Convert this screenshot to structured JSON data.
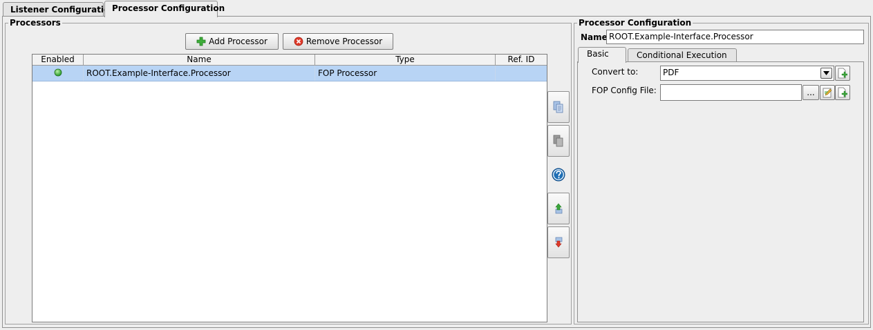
{
  "tabs": [
    {
      "label": "Listener Configuration",
      "active": false
    },
    {
      "label": "Processor Configuration",
      "active": true
    }
  ],
  "processors_panel": {
    "title": "Processors",
    "add_button": "Add Processor",
    "remove_button": "Remove Processor",
    "table": {
      "columns": [
        "Enabled",
        "Name",
        "Type",
        "Ref. ID"
      ],
      "rows": [
        {
          "enabled": true,
          "name": "ROOT.Example-Interface.Processor",
          "type": "FOP Processor",
          "ref_id": ""
        }
      ]
    },
    "side_buttons": [
      "copy-icon",
      "paste-icon",
      "help-icon",
      "move-up-icon",
      "move-down-icon"
    ]
  },
  "config_panel": {
    "title": "Processor Configuration",
    "name_label": "Name:",
    "name_value": "ROOT.Example-Interface.Processor",
    "subtabs": [
      {
        "label": "Basic",
        "active": true
      },
      {
        "label": "Conditional Execution",
        "active": false
      }
    ],
    "convert_to_label": "Convert to:",
    "convert_to_value": "PDF",
    "fop_config_label": "FOP Config File:",
    "fop_config_value": "",
    "browse_label": "..."
  },
  "colors": {
    "selection": "#b8d4f5",
    "enabled_dot": "#3cb43c",
    "help": "#1f6fb5"
  }
}
